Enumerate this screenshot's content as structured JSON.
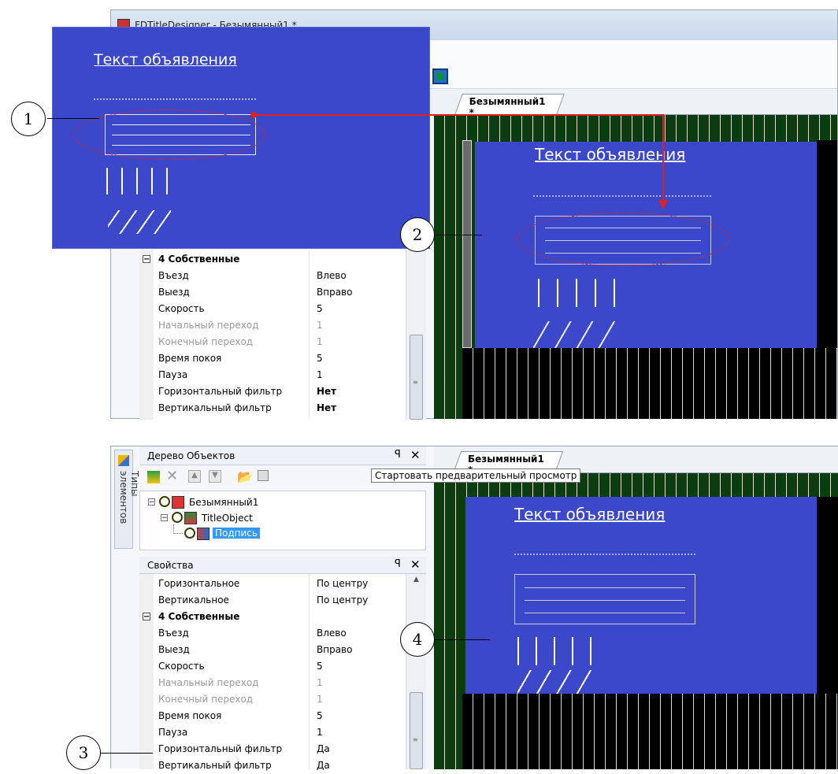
{
  "top": {
    "window_title": "FDTitleDesigner - Безымянный1 *",
    "doc_tab": "Безымянный1 *",
    "preview_title": "Текст объявления",
    "zoom_title": "Текст объявления",
    "section": "4 Собственные",
    "rows": [
      {
        "k": "Въезд",
        "v": "Влево",
        "dim": false,
        "bold": false
      },
      {
        "k": "Выезд",
        "v": "Вправо",
        "dim": false,
        "bold": false
      },
      {
        "k": "Скорость",
        "v": "5",
        "dim": false,
        "bold": false
      },
      {
        "k": "Начальный переход",
        "v": "1",
        "dim": true,
        "bold": false
      },
      {
        "k": "Конечный переход",
        "v": "1",
        "dim": true,
        "bold": false
      },
      {
        "k": "Время покоя",
        "v": "5",
        "dim": false,
        "bold": false
      },
      {
        "k": "Пауза",
        "v": "1",
        "dim": false,
        "bold": false
      },
      {
        "k": "Горизонтальный фильтр",
        "v": "Нет",
        "dim": false,
        "bold": true
      },
      {
        "k": "Вертикальный фильтр",
        "v": "Нет",
        "dim": false,
        "bold": true
      }
    ]
  },
  "bottom": {
    "tree_panel_title": "Дерево Объектов",
    "side_tab": "Типы элементов",
    "tree": [
      "Безымянный1",
      "TitleObject",
      "Подпись"
    ],
    "props_panel_title": "Свойства",
    "doc_tab": "Безымянный1 *",
    "tooltip": "Стартовать предварительный просмотр",
    "preview_title": "Текст объявления",
    "rows_top": [
      {
        "k": "Горизонтальное",
        "v": "По центру"
      },
      {
        "k": "Вертикальное",
        "v": "По центру"
      }
    ],
    "section": "4 Собственные",
    "rows": [
      {
        "k": "Въезд",
        "v": "Влево",
        "dim": false
      },
      {
        "k": "Выезд",
        "v": "Вправо",
        "dim": false
      },
      {
        "k": "Скорость",
        "v": "5",
        "dim": false
      },
      {
        "k": "Начальный переход",
        "v": "1",
        "dim": true
      },
      {
        "k": "Конечный переход",
        "v": "1",
        "dim": true
      },
      {
        "k": "Время покоя",
        "v": "5",
        "dim": false
      },
      {
        "k": "Пауза",
        "v": "1",
        "dim": false
      },
      {
        "k": "Горизонтальный фильтр",
        "v": "Да",
        "dim": false
      },
      {
        "k": "Вертикальный фильтр",
        "v": "Да",
        "dim": false
      }
    ]
  },
  "callouts": [
    "1",
    "2",
    "3",
    "4"
  ],
  "colors": {
    "blue": "#3b48c9",
    "dark_green": "#0b3d10",
    "red": "#e02020"
  }
}
